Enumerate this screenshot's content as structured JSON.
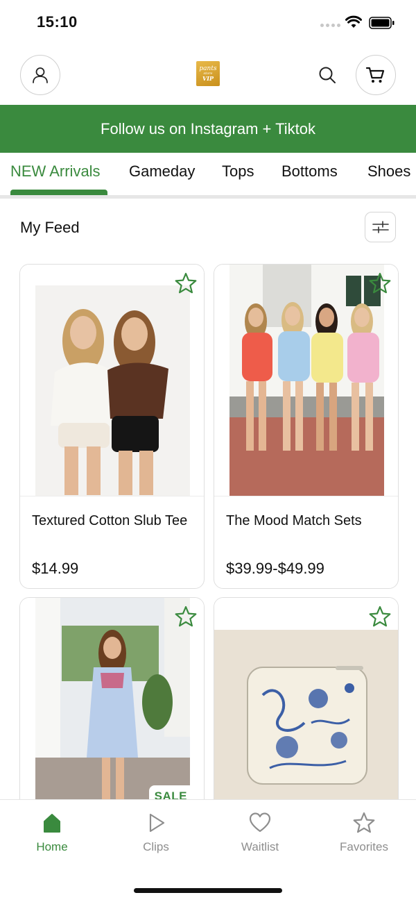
{
  "status_bar": {
    "time": "15:10"
  },
  "header": {
    "logo": "pants store VIP"
  },
  "promo_banner": {
    "text": "Follow us on Instagram + Tiktok"
  },
  "category_tabs": [
    {
      "label": "NEW Arrivals",
      "active": true
    },
    {
      "label": "Gameday",
      "active": false
    },
    {
      "label": "Tops",
      "active": false
    },
    {
      "label": "Bottoms",
      "active": false
    },
    {
      "label": "Shoes",
      "active": false
    }
  ],
  "feed": {
    "title": "My Feed"
  },
  "products": [
    {
      "name": "Textured Cotton Slub Tee",
      "price": "$14.99",
      "icon": "star-outline-icon"
    },
    {
      "name": "The Mood Match Sets",
      "price": "$39.99-$49.99",
      "icon": "star-outline-icon"
    },
    {
      "name": "",
      "price": "",
      "badge": "SALE",
      "icon": "star-outline-icon"
    },
    {
      "name": "",
      "price": "",
      "icon": "star-outline-icon"
    }
  ],
  "tab_bar": [
    {
      "label": "Home",
      "icon": "home-icon",
      "active": true
    },
    {
      "label": "Clips",
      "icon": "play-icon",
      "active": false
    },
    {
      "label": "Waitlist",
      "icon": "heart-icon",
      "active": false
    },
    {
      "label": "Favorites",
      "icon": "star-icon",
      "active": false
    }
  ],
  "colors": {
    "brand_green": "#3a8a3e",
    "inactive_gray": "#8e8e8e"
  }
}
